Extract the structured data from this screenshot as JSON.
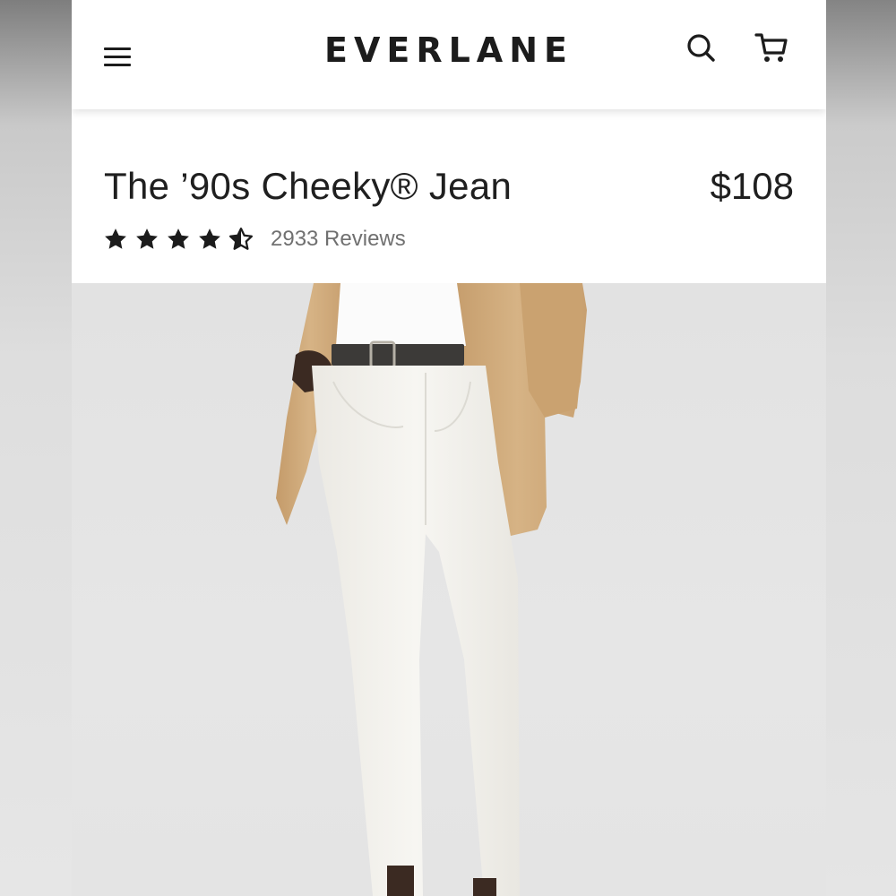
{
  "header": {
    "brand": "EVERLANE",
    "menu_icon": "hamburger-menu-icon",
    "search_icon": "search-icon",
    "cart_icon": "cart-icon"
  },
  "product": {
    "title": "The ’90s Cheeky® Jean",
    "price": "$108",
    "rating": 4.5,
    "rating_max": 5,
    "reviews": "2933 Reviews"
  },
  "image": {
    "description_icon": "product-photo"
  },
  "colors": {
    "text": "#1f1f1f",
    "muted": "#707070",
    "blazer": "#d4b083",
    "jeans": "#f4f2ec"
  }
}
